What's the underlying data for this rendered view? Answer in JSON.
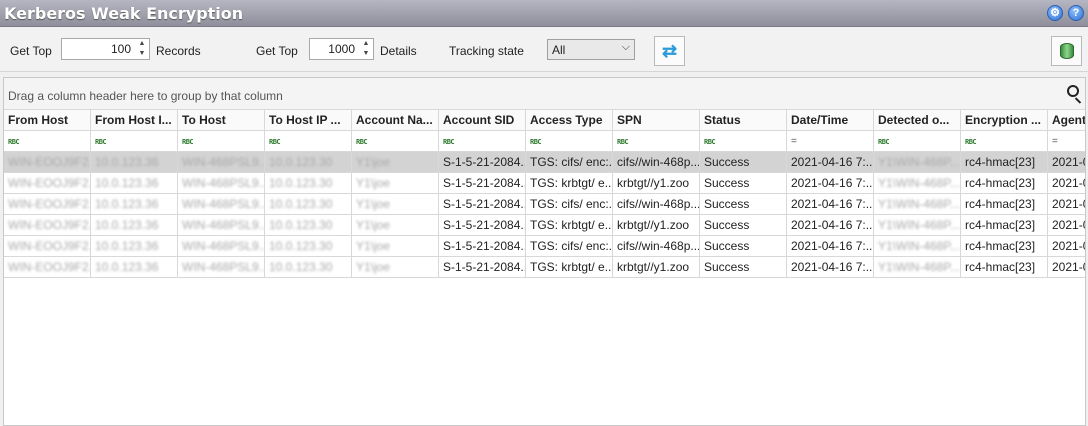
{
  "window": {
    "title": "Kerberos Weak Encryption",
    "icons": [
      "gear-icon",
      "help-icon"
    ]
  },
  "toolbar": {
    "get_top_label_1": "Get Top",
    "records_value": "100",
    "records_label": "Records",
    "get_top_label_2": "Get Top",
    "details_value": "1000",
    "details_label": "Details",
    "tracking_label": "Tracking state",
    "tracking_value": "All",
    "refresh_icon": "refresh-icon",
    "database_icon": "database-icon"
  },
  "grid": {
    "group_hint": "Drag a column header here to group by that column",
    "columns": [
      "From Host",
      "From Host I...",
      "To Host",
      "To Host IP ...",
      "Account Na...",
      "Account SID",
      "Access Type",
      "SPN",
      "Status",
      "Date/Time",
      "Detected o...",
      "Encryption ...",
      "Agent"
    ],
    "filters": [
      "RBC",
      "RBC",
      "RBC",
      "RBC",
      "RBC",
      "RBC",
      "RBC",
      "RBC",
      "RBC",
      "=",
      "RBC",
      "RBC",
      "="
    ],
    "rows": [
      [
        "WIN-EOOJ9F2...",
        "10.0.123.36",
        "WIN-468PSL9...",
        "10.0.123.30",
        "Y1\\joe",
        "S-1-5-21-2084...",
        "TGS: cifs/ enc:...",
        "cifs//win-468p...",
        "Success",
        "2021-04-16 7:...",
        "Y1\\WIN-468P...",
        "rc4-hmac[23]",
        "2021-0"
      ],
      [
        "WIN-EOOJ9F2...",
        "10.0.123.36",
        "WIN-468PSL9...",
        "10.0.123.30",
        "Y1\\joe",
        "S-1-5-21-2084...",
        "TGS: krbtgt/ e...",
        "krbtgt//y1.zoo",
        "Success",
        "2021-04-16 7:...",
        "Y1\\WIN-468P...",
        "rc4-hmac[23]",
        "2021-0"
      ],
      [
        "WIN-EOOJ9F2...",
        "10.0.123.36",
        "WIN-468PSL9...",
        "10.0.123.30",
        "Y1\\joe",
        "S-1-5-21-2084...",
        "TGS: cifs/ enc:...",
        "cifs//win-468p...",
        "Success",
        "2021-04-16 7:...",
        "Y1\\WIN-468P...",
        "rc4-hmac[23]",
        "2021-0"
      ],
      [
        "WIN-EOOJ9F2...",
        "10.0.123.36",
        "WIN-468PSL9...",
        "10.0.123.30",
        "Y1\\joe",
        "S-1-5-21-2084...",
        "TGS: krbtgt/ e...",
        "krbtgt//y1.zoo",
        "Success",
        "2021-04-16 7:...",
        "Y1\\WIN-468P...",
        "rc4-hmac[23]",
        "2021-0"
      ],
      [
        "WIN-EOOJ9F2...",
        "10.0.123.36",
        "WIN-468PSL9...",
        "10.0.123.30",
        "Y1\\joe",
        "S-1-5-21-2084...",
        "TGS: cifs/ enc:...",
        "cifs//win-468p...",
        "Success",
        "2021-04-16 7:...",
        "Y1\\WIN-468P...",
        "rc4-hmac[23]",
        "2021-0"
      ],
      [
        "WIN-EOOJ9F2...",
        "10.0.123.36",
        "WIN-468PSL9...",
        "10.0.123.30",
        "Y1\\joe",
        "S-1-5-21-2084...",
        "TGS: krbtgt/ e...",
        "krbtgt//y1.zoo",
        "Success",
        "2021-04-16 7:...",
        "Y1\\WIN-468P...",
        "rc4-hmac[23]",
        "2021-0"
      ]
    ],
    "blurred_columns": [
      0,
      1,
      2,
      3,
      4,
      10
    ]
  }
}
